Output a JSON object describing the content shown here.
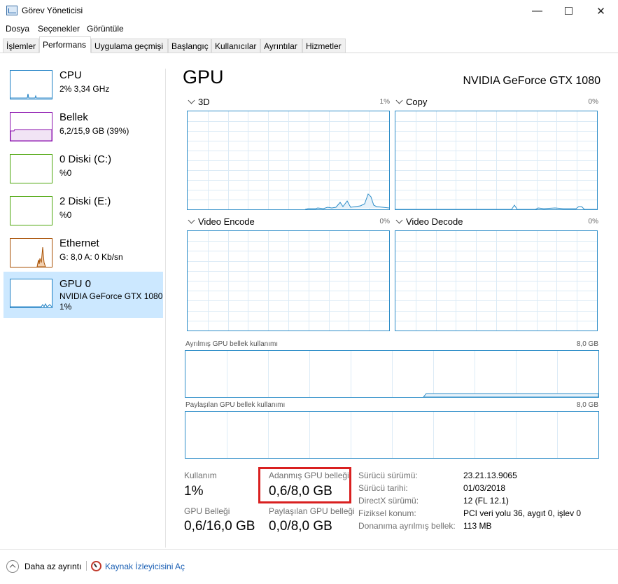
{
  "window": {
    "title": "Görev Yöneticisi",
    "minimize": "—",
    "maximize": "☐",
    "close": "✕"
  },
  "menu": [
    "Dosya",
    "Seçenekler",
    "Görüntüle"
  ],
  "tabs": [
    "İşlemler",
    "Performans",
    "Uygulama geçmişi",
    "Başlangıç",
    "Kullanıcılar",
    "Ayrıntılar",
    "Hizmetler"
  ],
  "active_tab": "Performans",
  "sidebar": [
    {
      "title": "CPU",
      "sub": "2% 3,34 GHz",
      "sub2": "",
      "color": "#1c7fc4",
      "icon": "cpu-graph-icon"
    },
    {
      "title": "Bellek",
      "sub": "6,2/15,9 GB (39%)",
      "sub2": "",
      "color": "#8b12ae",
      "icon": "memory-graph-icon"
    },
    {
      "title": "0 Diski (C:)",
      "sub": "%0",
      "sub2": "",
      "color": "#4da60c",
      "icon": "disk-graph-icon"
    },
    {
      "title": "2 Diski (E:)",
      "sub": "%0",
      "sub2": "",
      "color": "#4da60c",
      "icon": "disk-graph-icon"
    },
    {
      "title": "Ethernet",
      "sub": "G: 8,0 A: 0 Kb/sn",
      "sub2": "",
      "color": "#a74f01",
      "icon": "ethernet-graph-icon"
    },
    {
      "title": "GPU 0",
      "sub": "NVIDIA GeForce GTX 1080",
      "sub2": "1%",
      "color": "#1c7fc4",
      "icon": "gpu-graph-icon"
    }
  ],
  "main": {
    "title": "GPU",
    "model": "NVIDIA GeForce GTX 1080",
    "engines": [
      {
        "label": "3D",
        "pct": "1%"
      },
      {
        "label": "Copy",
        "pct": "0%"
      },
      {
        "label": "Video Encode",
        "pct": "0%"
      },
      {
        "label": "Video Decode",
        "pct": "0%"
      }
    ],
    "dedicated_label": "Ayrılmış GPU bellek kullanımı",
    "dedicated_max": "8,0 GB",
    "shared_label": "Paylaşılan GPU bellek kullanımı",
    "shared_max": "8,0 GB"
  },
  "stats": {
    "usage_label": "Kullanım",
    "usage_value": "1%",
    "dedicated_label": "Adanmış GPU belleği",
    "dedicated_value": "0,6/8,0 GB",
    "gpu_mem_label": "GPU Belleği",
    "gpu_mem_value": "0,6/16,0 GB",
    "shared_label": "Paylaşılan GPU belleği",
    "shared_value": "0,0/8,0 GB"
  },
  "info": [
    {
      "key": "Sürücü sürümü:",
      "value": "23.21.13.9065"
    },
    {
      "key": "Sürücü tarihi:",
      "value": "01/03/2018"
    },
    {
      "key": "DirectX sürümü:",
      "value": "12 (FL 12.1)"
    },
    {
      "key": "Fiziksel konum:",
      "value": "PCI veri yolu 36, aygıt 0, işlev 0"
    },
    {
      "key": "Donanıma ayrılmış bellek:",
      "value": "113 MB"
    }
  ],
  "footer": {
    "fewer_details": "Daha az ayrıntı",
    "resource_monitor": "Kaynak İzleyicisini Aç"
  },
  "colors": {
    "accent": "#2d8dc8",
    "highlight": "#d92020",
    "selected_bg": "#cce8ff"
  }
}
